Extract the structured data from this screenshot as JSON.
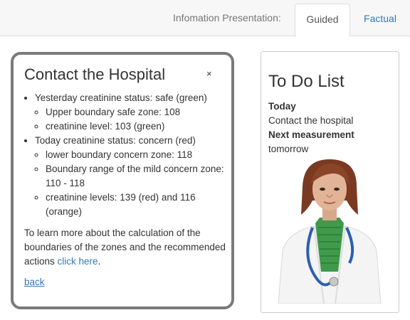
{
  "nav": {
    "label": "Infomation Presentation:",
    "tabs": [
      {
        "label": "Guided",
        "active": true
      },
      {
        "label": "Factual",
        "active": false
      }
    ]
  },
  "popup": {
    "title": "Contact the Hospital",
    "close": "×",
    "items": [
      {
        "text": "Yesterday creatinine status: safe (green)",
        "sub": [
          "Upper boundary safe zone: 108",
          "creatinine level: 103 (green)"
        ]
      },
      {
        "text": "Today creatinine status: concern (red)",
        "sub": [
          "lower boundary concern zone: 118",
          "Boundary range of the mild concern zone: 110 - 118",
          "creatinine levels: 139 (red) and 116 (orange)"
        ]
      }
    ],
    "more_text": "To learn more about the calculation of the boundaries of the zones and the recommended actions ",
    "more_link": "click here",
    "more_end": ".",
    "back": "back"
  },
  "todo": {
    "title": "To Do List",
    "today_label": "Today",
    "today_item": "Contact the hospital",
    "next_label": "Next measurement",
    "next_item": "tomorrow"
  },
  "colors": {
    "link": "#337ab7",
    "bubble_border": "#7a7a7a"
  },
  "icons": {
    "close": "close-icon",
    "avatar": "doctor-avatar"
  }
}
